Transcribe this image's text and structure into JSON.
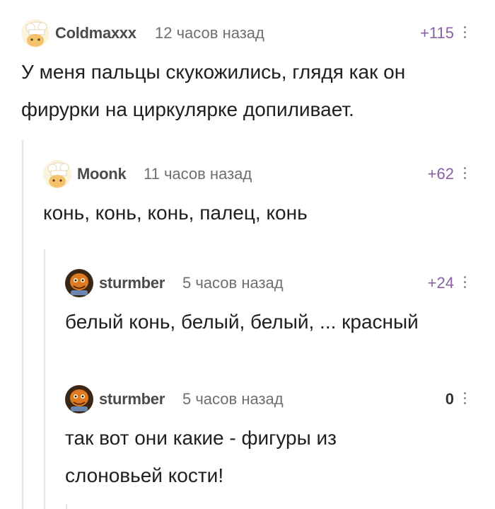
{
  "comments": [
    {
      "author": "Coldmaxxx",
      "time": "12 часов назад",
      "rating": "+115",
      "avatar": "chef-hat-avatar",
      "text_lines": [
        "У меня пальцы скукожились, глядя как он",
        "фирурки на циркулярке допиливает."
      ]
    },
    {
      "author": "Moonk",
      "time": "11 часов назад",
      "rating": "+62",
      "avatar": "chef-hat-avatar",
      "text_lines": [
        "конь, конь, конь, палец, конь"
      ]
    },
    {
      "author": "sturmber",
      "time": "5 часов назад",
      "rating": "+24",
      "avatar": "orange-creature-avatar",
      "text_lines": [
        "белый конь, белый, белый, ... красный"
      ]
    },
    {
      "author": "sturmber",
      "time": "5 часов назад",
      "rating": "0",
      "avatar": "orange-creature-avatar",
      "text_lines": [
        "так вот они какие - фигуры из",
        "слоновьей кости!"
      ]
    }
  ],
  "colors": {
    "rating_positive": "#8a5fa6",
    "branch_line": "#e6e6e6"
  }
}
